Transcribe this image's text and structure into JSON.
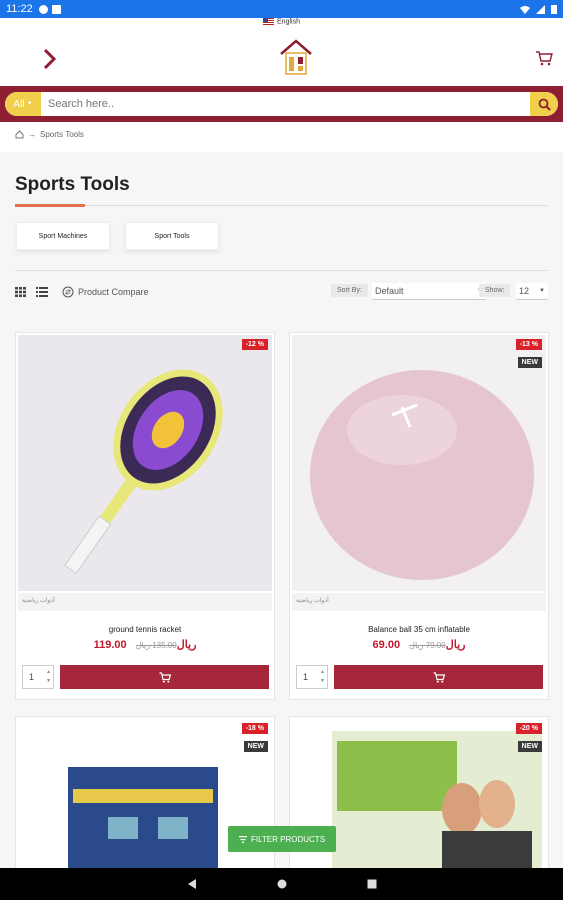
{
  "status": {
    "time": "11:22"
  },
  "lang": {
    "label": "English"
  },
  "search": {
    "category": "All",
    "placeholder": "Search here.."
  },
  "breadcrumb": {
    "current": "Sports Tools",
    "sep": "→"
  },
  "page": {
    "title": "Sports Tools"
  },
  "subcategories": [
    "Sport Machines",
    "Sport Tools"
  ],
  "toolbar": {
    "compare_label": "Product Compare",
    "sort_label": "Sort By:",
    "sort_value": "Default",
    "show_label": "Show:",
    "show_value": "12"
  },
  "products": [
    {
      "name": "ground tennis racket",
      "price": "119.00 ريال",
      "old_price": "135.00 ريال",
      "discount": "-12 %",
      "new": "",
      "category": "أدوات رياضية",
      "qty": "1"
    },
    {
      "name": "Balance ball 35 cm inflatable",
      "price": "69.00 ريال",
      "old_price": "79.00 ريال",
      "discount": "-13 %",
      "new": "NEW",
      "category": "أدوات رياضية",
      "qty": "1"
    },
    {
      "discount": "-18 %",
      "new": "NEW"
    },
    {
      "discount": "-20 %",
      "new": "NEW"
    }
  ],
  "filter": {
    "label": "FILTER PRODUCTS"
  },
  "colors": {
    "brand": "#8e1f33",
    "accent": "#f0cf4a",
    "add_to_cart": "#a6263b",
    "discount": "#d8222a",
    "filter": "#4caf50"
  }
}
